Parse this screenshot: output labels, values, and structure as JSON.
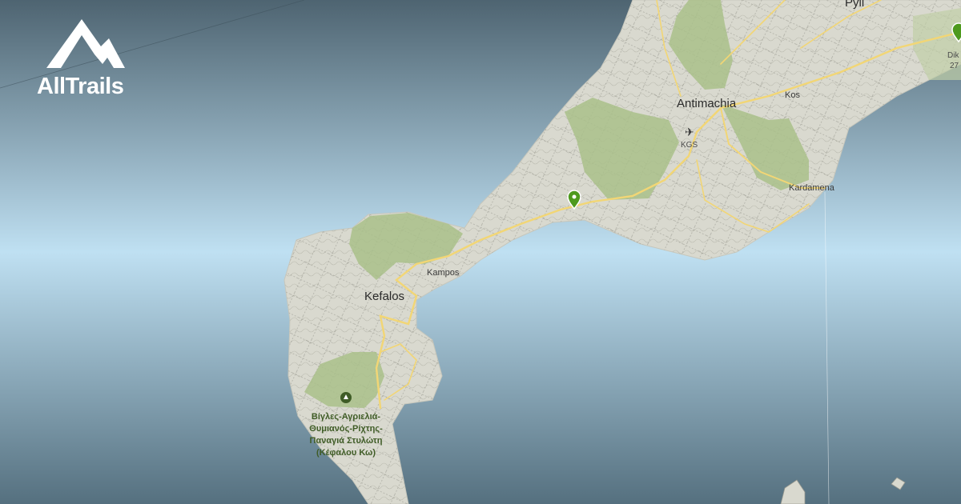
{
  "brand": {
    "name": "AllTrails",
    "icon": "mountain-logo-icon"
  },
  "places": {
    "pyli": "Pyli",
    "antimachia": "Antimachia",
    "kos": "Kos",
    "kgs": "KGS",
    "kardamena": "Kardamena",
    "kampos": "Kampos",
    "kefalos": "Kefalos",
    "dik": "Dik",
    "dik_num": "27"
  },
  "park": {
    "lines": [
      "Βίγλες-Αγριελιά-",
      "Θυμιανός-Ρίχτης-",
      "Παναγιά Στυλώτη",
      "(Κέφαλου Κω)"
    ]
  },
  "colors": {
    "sea_top": "#4e6471",
    "sea_mid": "#bfe0f2",
    "sea_bottom": "#55707f",
    "land": "#d9d9cf",
    "forest": "#a9c08a",
    "road": "#f2d675",
    "pin": "#4e9a1e"
  },
  "icons": [
    "airport-icon",
    "trail-pin-icon",
    "park-icon"
  ]
}
